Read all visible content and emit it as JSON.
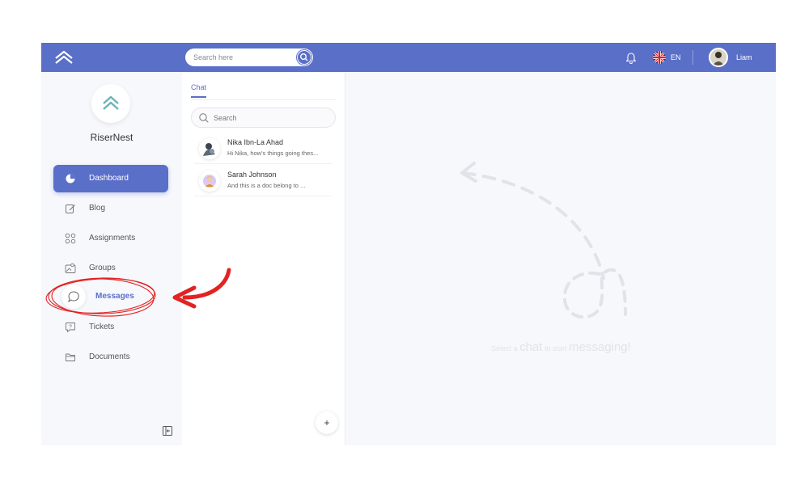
{
  "topbar": {
    "search_placeholder": "Search here",
    "language": "EN",
    "user_name": "Liam"
  },
  "sidebar": {
    "brand_name": "RiserNest",
    "items": [
      {
        "label": "Dashboard",
        "icon": "pie-chart-icon",
        "active": true
      },
      {
        "label": "Blog",
        "icon": "edit-icon"
      },
      {
        "label": "Assignments",
        "icon": "nodes-icon"
      },
      {
        "label": "Groups",
        "icon": "image-group-icon"
      },
      {
        "label": "Messages",
        "icon": "chat-bubble-icon",
        "highlighted": true
      },
      {
        "label": "Tickets",
        "icon": "help-message-icon"
      },
      {
        "label": "Documents",
        "icon": "folder-icon"
      }
    ]
  },
  "chat_panel": {
    "tab_label": "Chat",
    "search_placeholder": "Search",
    "conversations": [
      {
        "name": "Nika Ibn-La Ahad",
        "preview": "Hi Nika, how's things going thes..."
      },
      {
        "name": "Sarah Johnson",
        "preview": "And this is a doc belong to ..."
      }
    ],
    "add_label": "+"
  },
  "main": {
    "empty_parts": {
      "p1": "Select a",
      "p2": "chat",
      "p3": "to start",
      "p4": "messaging!"
    }
  },
  "colors": {
    "accent": "#5a6fc8",
    "annotation": "#e32222",
    "logo_teal": "#6bb4b8"
  }
}
